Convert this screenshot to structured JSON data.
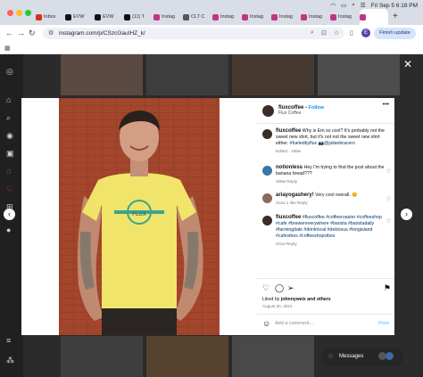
{
  "browser": {
    "tabs": [
      {
        "label": "Inbox",
        "color": "#d93025"
      },
      {
        "label": "EVW",
        "color": "#111111"
      },
      {
        "label": "EVW",
        "color": "#111111"
      },
      {
        "label": "(11) T",
        "color": "#111111"
      },
      {
        "label": "Instag",
        "color": "#c13584"
      },
      {
        "label": "CLT C",
        "color": "#555555"
      },
      {
        "label": "Instag",
        "color": "#c13584"
      },
      {
        "label": "Instag",
        "color": "#c13584"
      },
      {
        "label": "Instag",
        "color": "#c13584"
      },
      {
        "label": "Instag",
        "color": "#c13584"
      },
      {
        "label": "Instag",
        "color": "#c13584"
      },
      {
        "label": "",
        "color": "#c13584"
      }
    ],
    "new_tab": "+",
    "clock": "Fri Sep 5  6:18 PM",
    "url": "instagram.com/p/CSzcGauIHZ_k/",
    "profile_initial": "E",
    "finish_update": "Finish update"
  },
  "post": {
    "username": "fluxcoffee",
    "follow_label": "Follow",
    "location": "Flux Coffee",
    "caption": {
      "user": "fluxcoffee",
      "text": "Why is Em so cool? It's probably not the sweet new shirt, but it's not not the sweet new shirt either. ",
      "tags": "#fueledbyflux 📷@julianbracero",
      "meta": "Edited · 166w"
    },
    "comments": [
      {
        "user": "notionless",
        "text": "Hey I'm trying to find the post about the banana bread???",
        "meta": "208w   Reply"
      },
      {
        "user": "ariayogashery!",
        "text": "Very cool overall. 😊",
        "meta": "211w   1 like   Reply"
      },
      {
        "user": "fluxcoffee",
        "text": "#fluxcoffee #coffeeroaster #coffeeshop #cafe #brewereverywhere #barista #baristadaily #farmingdale #drinklocal #delicious #longisland #cafevibes #coffeeshopvibes",
        "meta": "211w   Reply"
      }
    ],
    "liked_by_prefix": "Liked by ",
    "liked_by_user": "johnnyweiz",
    "liked_by_suffix": " and others",
    "date": "August 20, 2021",
    "add_comment_placeholder": "Add a comment...",
    "post_label": "Post",
    "shirt_text": "FLUX"
  },
  "messages": {
    "label": "Messages"
  },
  "colors": {
    "accent": "#0095f6",
    "brick": "#a3462b",
    "shirt": "#f0e46a"
  }
}
